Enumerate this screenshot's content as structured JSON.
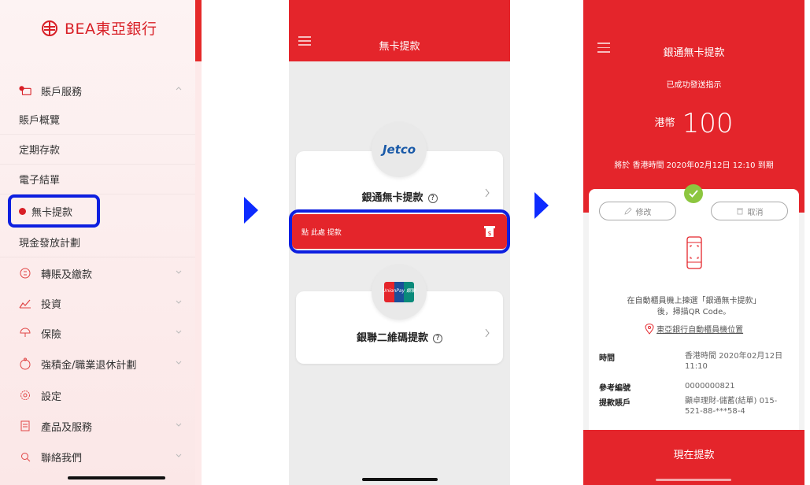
{
  "colors": {
    "brand_red": "#e4252b",
    "highlight_blue": "#0d1fe0",
    "success_green": "#8cc63f",
    "flow_arrow": "#0d2bff"
  },
  "menu": {
    "logo_text": "BEA東亞銀行",
    "sections": [
      {
        "label": "賬戶服務",
        "icon": "wallet-icon",
        "badge": true,
        "expanded": true
      }
    ],
    "sub_items": [
      "賬戶概覽",
      "定期存款",
      "電子結單",
      "無卡提款",
      "現金發放計劃"
    ],
    "items": [
      {
        "label": "轉賬及繳款",
        "icon": "transfer-icon",
        "expandable": true
      },
      {
        "label": "投資",
        "icon": "chart-icon",
        "expandable": true
      },
      {
        "label": "保險",
        "icon": "umbrella-icon",
        "expandable": true
      },
      {
        "label": "強積金/職業退休計劃",
        "icon": "piggy-bank-icon",
        "expandable": true
      },
      {
        "label": "設定",
        "icon": "gear-icon",
        "expandable": false
      },
      {
        "label": "產品及服務",
        "icon": "document-icon",
        "expandable": true
      },
      {
        "label": "聯絡我們",
        "icon": "search-icon",
        "expandable": true
      }
    ]
  },
  "screen2": {
    "title": "無卡提款",
    "card1": {
      "logo": "Jetco",
      "title": "銀通無卡提款",
      "help": "?"
    },
    "click_bar": "點 此處 提款",
    "card2": {
      "logo": "UnionPay 銀聯",
      "title": "銀聯二維碼提款",
      "help": "?"
    }
  },
  "screen3": {
    "title": "銀通無卡提款",
    "status": "已成功發送指示",
    "currency": "港幣",
    "amount": "100",
    "expiry": "將於 香港時間 2020年02月12日 12:10 到期",
    "edit_label": "修改",
    "cancel_label": "取消",
    "instruction_line1": "在自動櫃員機上揀選「銀通無卡提款」",
    "instruction_line2": "後，掃描QR Code。",
    "atm_link": "東亞銀行自動櫃員機位置",
    "details": [
      {
        "label": "時間",
        "value": "香港時間 2020年02月12日 11:10"
      },
      {
        "label": "參考編號",
        "value": "0000000821"
      },
      {
        "label": "提款賬戶",
        "value": "顯卓理財-儲蓄(結單) 015-521-88-***58-4"
      }
    ],
    "action": "現在提款"
  }
}
